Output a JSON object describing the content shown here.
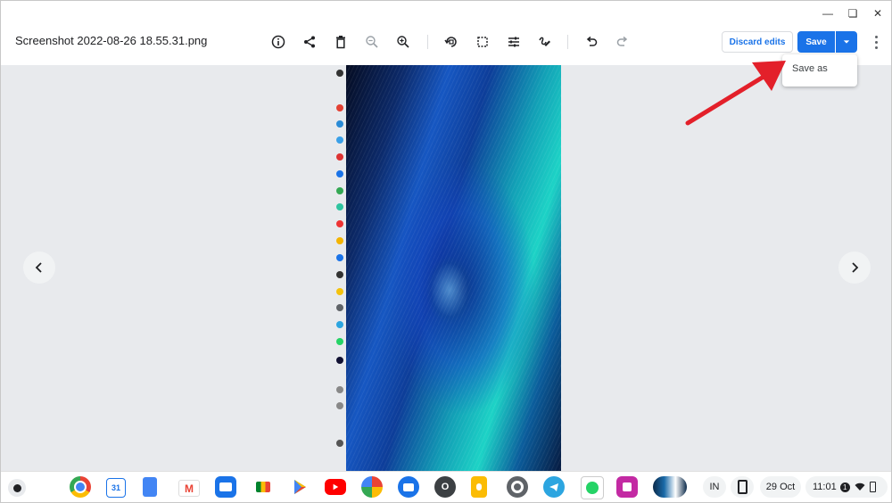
{
  "window": {
    "minimize_icon": "minimize-icon",
    "restore_icon": "restore-icon",
    "close_icon": "close-icon"
  },
  "file": {
    "title": "Screenshot 2022-08-26 18.55.31.png"
  },
  "toolbar": {
    "tools": [
      "info-icon",
      "share-icon",
      "delete-icon",
      "zoom-out-icon",
      "zoom-in-icon",
      "rotate-icon",
      "crop-icon",
      "adjust-icon",
      "annotate-icon",
      "undo-icon",
      "redo-icon"
    ],
    "discard_label": "Discard edits",
    "save_label": "Save",
    "more_icon": "more-vert-icon"
  },
  "save_menu": {
    "save_as_label": "Save as"
  },
  "annotation": {
    "arrow_color": "#e3202a"
  },
  "colors": {
    "accent": "#1a73e8",
    "viewer_bg": "#e8eaed"
  },
  "shelf": {
    "apps": [
      "Chrome",
      "Calendar",
      "Docs",
      "Gmail",
      "Files",
      "Meet",
      "Play Store",
      "YouTube",
      "Photos",
      "Messages",
      "O",
      "Keep",
      "Settings",
      "Telegram",
      "WhatsApp",
      "Screenshot app",
      "Photo app"
    ],
    "calendar_day": "31",
    "o_app_label": "O",
    "ime_label": "IN",
    "date_label": "29 Oct",
    "time_label": "11:01",
    "notification_count": "1"
  }
}
